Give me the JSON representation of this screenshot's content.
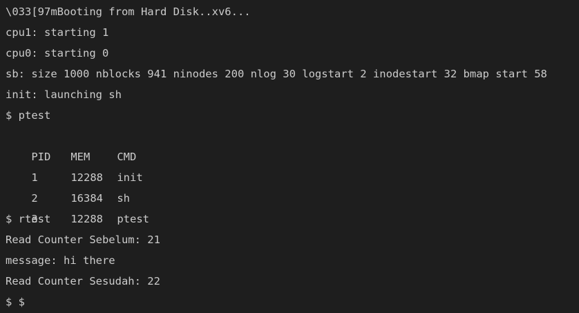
{
  "terminal": {
    "boot_line": "\\033[97mBooting from Hard Disk..xv6...",
    "cpu1_line": "cpu1: starting 1",
    "cpu0_line": "cpu0: starting 0",
    "sb_line": "sb: size 1000 nblocks 941 ninodes 200 nlog 30 logstart 2 inodestart 32 bmap start 58",
    "init_line": "init: launching sh",
    "cmd_ptest": "$ ptest",
    "process_table": {
      "headers": [
        "PID",
        "MEM",
        "CMD"
      ],
      "rows": [
        [
          "1",
          "12288",
          "init"
        ],
        [
          "2",
          "16384",
          "sh"
        ],
        [
          "3",
          "12288",
          "ptest"
        ]
      ]
    },
    "cmd_rtest": "$ rtest",
    "read_before": "Read Counter Sebelum: 21",
    "message_line": "message: hi there",
    "read_after": "Read Counter Sesudah: 22",
    "prompt_line": "$ $"
  }
}
